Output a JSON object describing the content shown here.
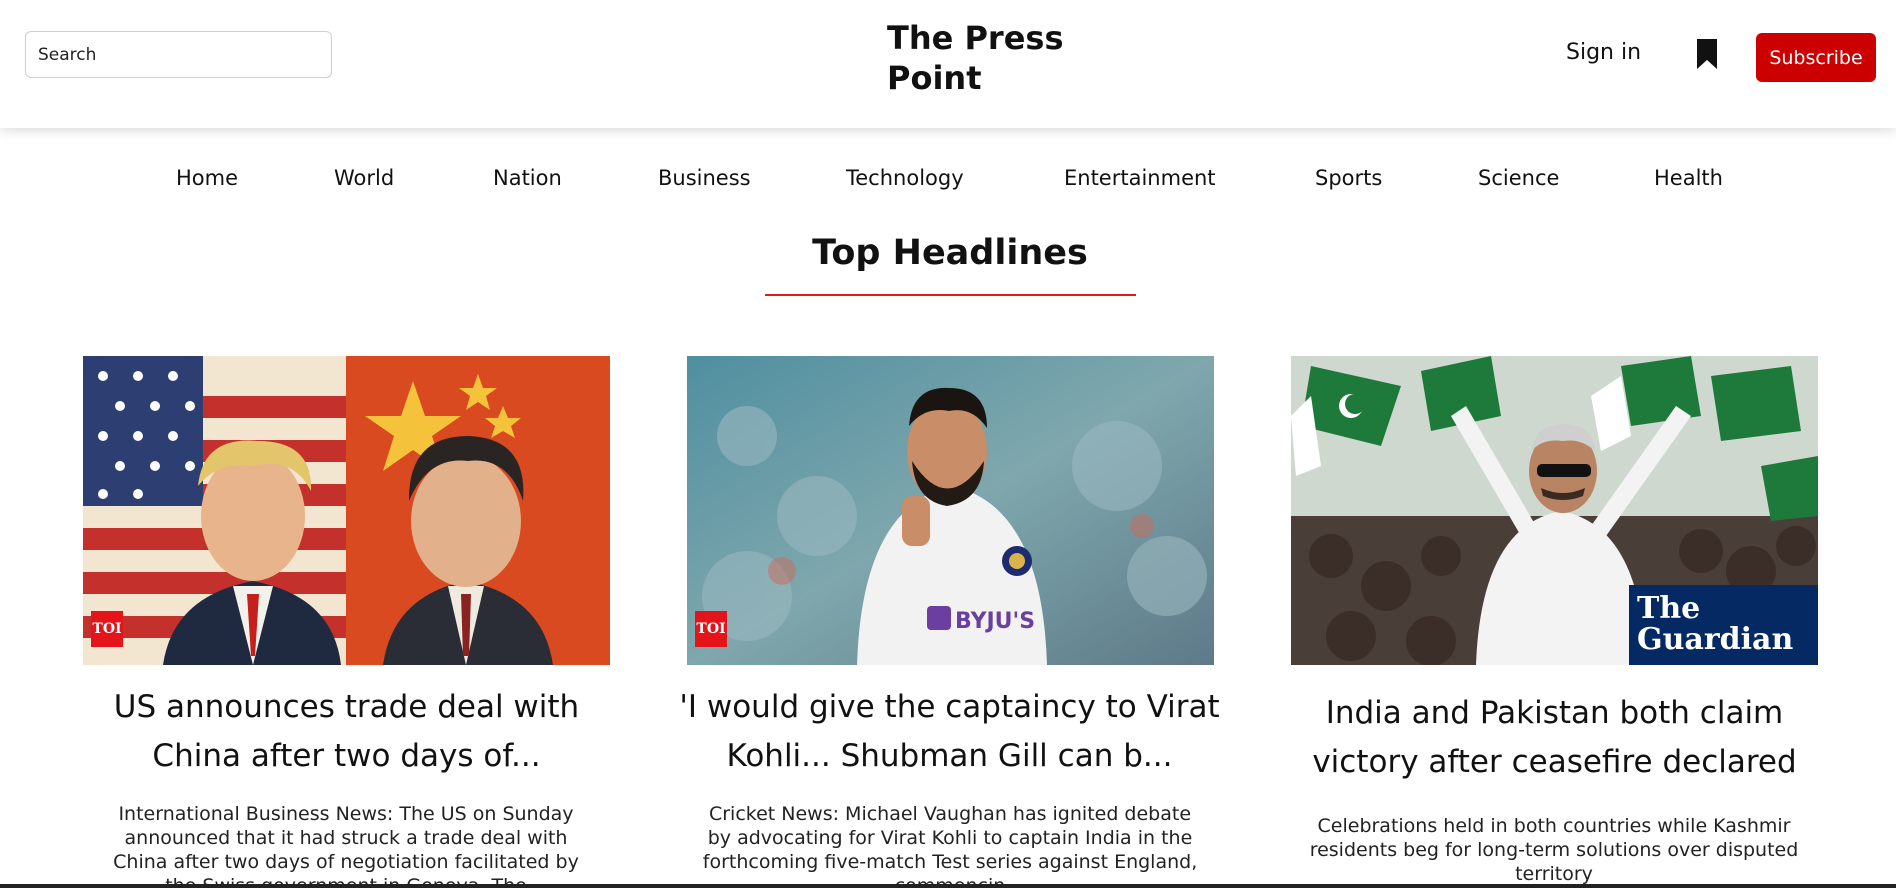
{
  "header": {
    "search_placeholder": "Search",
    "brand": "The Press Point",
    "sign_in": "Sign in",
    "subscribe": "Subscribe"
  },
  "nav": {
    "items": [
      "Home",
      "World",
      "Nation",
      "Business",
      "Technology",
      "Entertainment",
      "Sports",
      "Science",
      "Health"
    ]
  },
  "section_title": "Top Headlines",
  "articles": [
    {
      "title": "US announces trade deal with China after two days of...",
      "description": "International Business News: The US on Sunday announced that it had struck a trade deal with China after two days of negotiation facilitated by the Swiss government in Geneva. The",
      "source_logo": "TOI"
    },
    {
      "title": "'I would give the captaincy to Virat Kohli... Shubman Gill can b...",
      "description": "Cricket News: Michael Vaughan has ignited debate by advocating for Virat Kohli to captain India in the forthcoming five-match Test series against England, commencin",
      "source_logo": "TOI"
    },
    {
      "title": "India and Pakistan both claim victory after ceasefire declared",
      "description": "Celebrations held in both countries while Kashmir residents beg for long-term solutions over disputed territory",
      "source_logo": "The Guardian"
    }
  ],
  "colors": {
    "accent": "#cc0000",
    "rule": "#e31a1a",
    "guardian_blue": "#052962"
  }
}
